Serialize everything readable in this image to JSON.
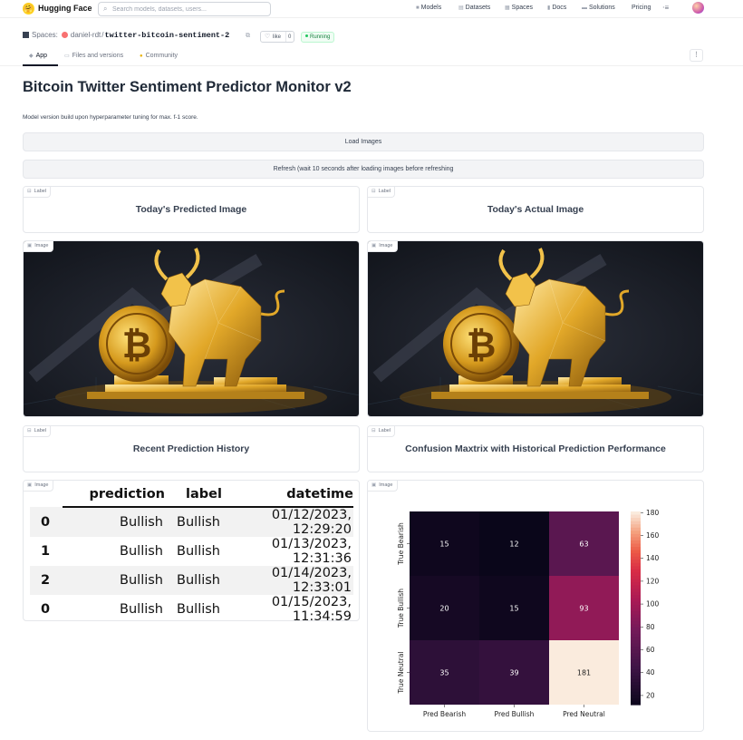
{
  "nav": {
    "brand": "Hugging Face",
    "search_placeholder": "Search models, datasets, users...",
    "links": [
      "Models",
      "Datasets",
      "Spaces",
      "Docs",
      "Solutions",
      "Pricing"
    ]
  },
  "space": {
    "prefix": "Spaces:",
    "owner": "daniel-rdt",
    "separator": "/",
    "repo": "twitter-bitcoin-sentiment-2",
    "like_label": "like",
    "like_count": "0",
    "status": "Running"
  },
  "tabs": [
    "App",
    "Files and versions",
    "Community"
  ],
  "app": {
    "title": "Bitcoin Twitter Sentiment Predictor Monitor v2",
    "description": "Model version build upon hyperparameter tuning for max. f-1 score.",
    "load_button": "Load Images",
    "refresh_button": "Refresh (wait 10 seconds after loading images before refreshing"
  },
  "panels": {
    "label_tag": "Label",
    "image_tag": "Image",
    "predicted_title": "Today's Predicted Image",
    "actual_title": "Today's Actual Image",
    "history_title": "Recent Prediction History",
    "confusion_title": "Confusion Maxtrix with Historical Prediction Performance"
  },
  "history_table": {
    "columns": [
      "prediction",
      "label",
      "datetime"
    ],
    "rows": [
      {
        "index": "0",
        "prediction": "Bullish",
        "label": "Bullish",
        "datetime": "01/12/2023, 12:29:20"
      },
      {
        "index": "1",
        "prediction": "Bullish",
        "label": "Bullish",
        "datetime": "01/13/2023, 12:31:36"
      },
      {
        "index": "2",
        "prediction": "Bullish",
        "label": "Bullish",
        "datetime": "01/14/2023, 12:33:01"
      },
      {
        "index": "0",
        "prediction": "Bullish",
        "label": "Bullish",
        "datetime": "01/15/2023, 11:34:59"
      }
    ]
  },
  "chart_data": {
    "type": "heatmap",
    "rows": [
      "True Bearish",
      "True Bullish",
      "True Neutral"
    ],
    "columns": [
      "Pred Bearish",
      "Pred Bullish",
      "Pred Neutral"
    ],
    "values": [
      [
        15,
        12,
        63
      ],
      [
        20,
        15,
        93
      ],
      [
        35,
        39,
        181
      ]
    ],
    "colorbar_ticks": [
      20,
      40,
      60,
      80,
      100,
      120,
      140,
      160,
      180
    ],
    "colorbar_range": [
      12,
      181
    ]
  }
}
